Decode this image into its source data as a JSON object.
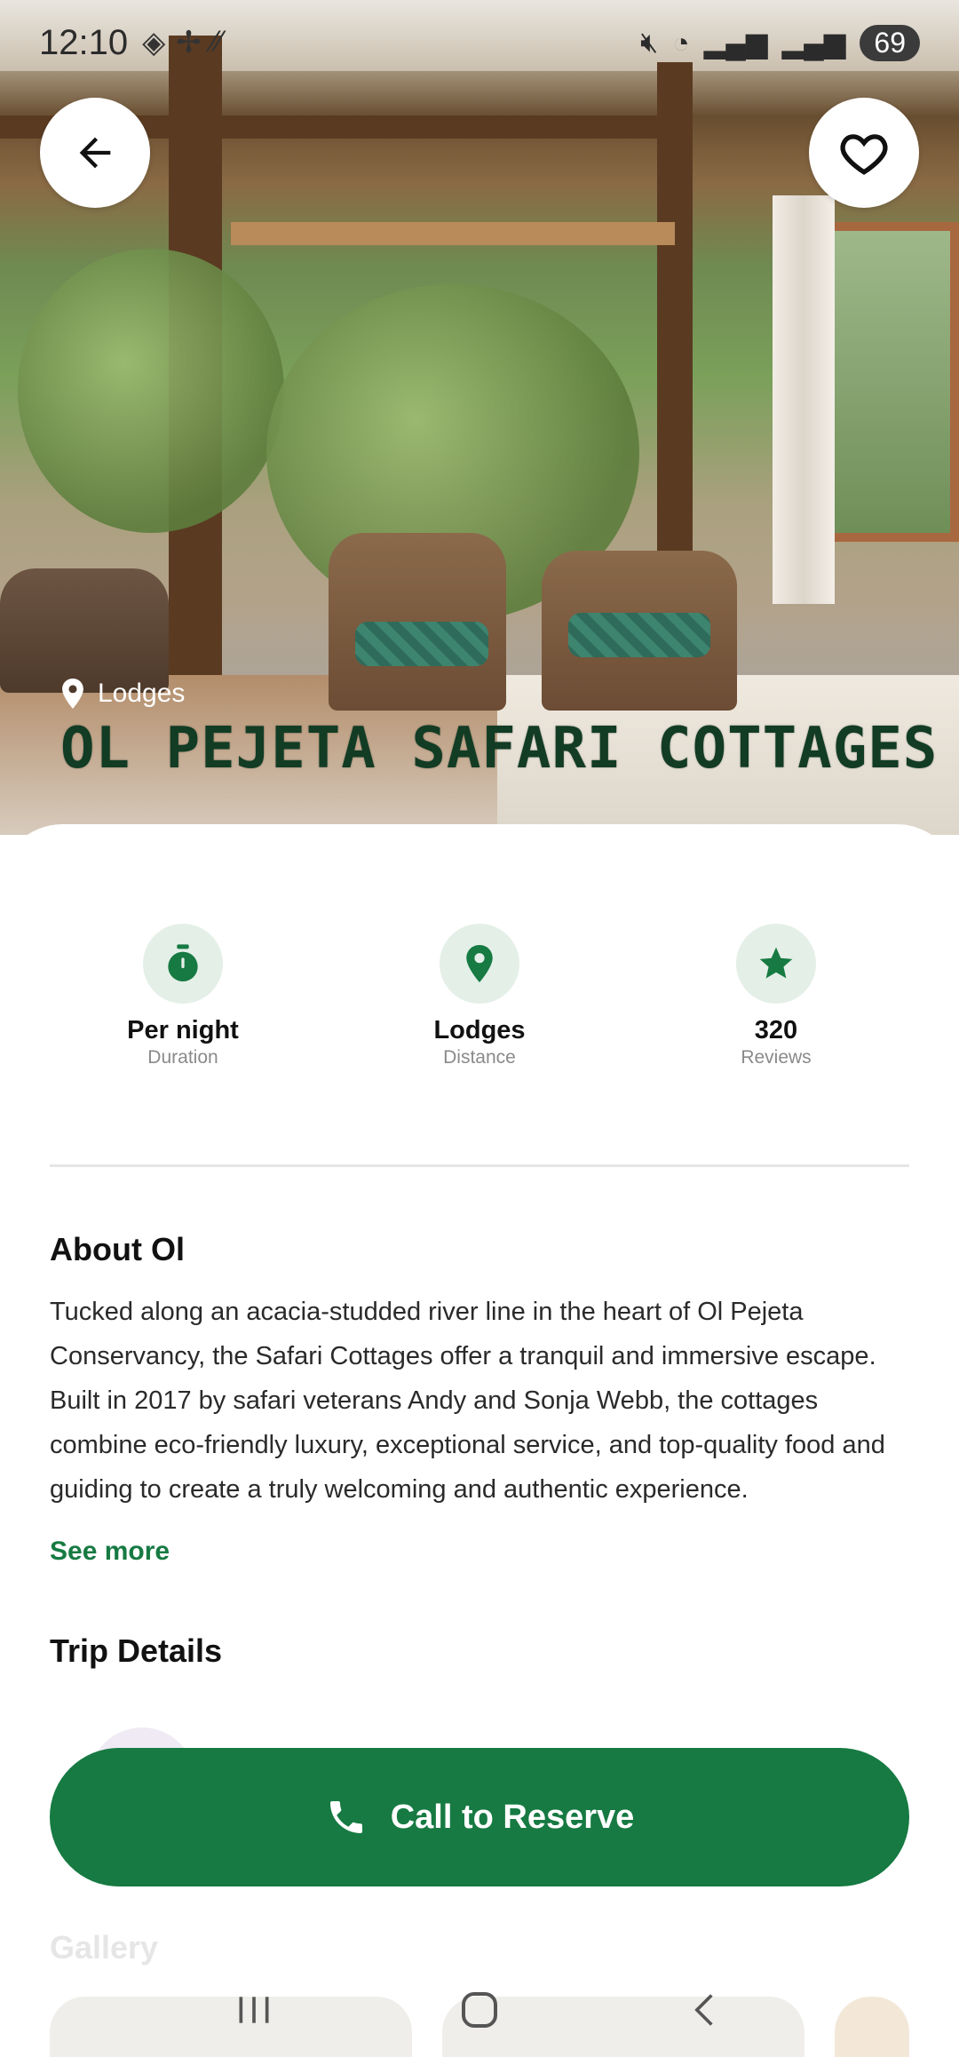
{
  "status_bar": {
    "time": "12:10",
    "battery": "69"
  },
  "hero": {
    "category": "Lodges",
    "title": "OL PEJETA SAFARI COTTAGES"
  },
  "stats": [
    {
      "icon": "stopwatch-icon",
      "value": "Per night",
      "label": "Duration"
    },
    {
      "icon": "location-pin-icon",
      "value": "Lodges",
      "label": "Distance"
    },
    {
      "icon": "star-icon",
      "value": "320",
      "label": "Reviews"
    }
  ],
  "about": {
    "title": "About Ol",
    "text": "Tucked along an acacia-studded river line in the heart of Ol Pejeta Conservancy, the Safari Cottages offer a tranquil and immersive escape. Built in 2017 by safari veterans Andy and Sonja Webb, the cottages combine eco-friendly luxury, exceptional service, and top-quality food and guiding to create a truly welcoming and authentic experience.",
    "see_more": "See more"
  },
  "trip_details": {
    "title": "Trip Details"
  },
  "cta": {
    "label": "Call to Reserve",
    "icon": "phone-icon"
  },
  "gallery": {
    "title": "Gallery"
  },
  "colors": {
    "accent": "#167a42",
    "accent_light": "#e4efe8",
    "title_dark_green": "#123c24"
  }
}
